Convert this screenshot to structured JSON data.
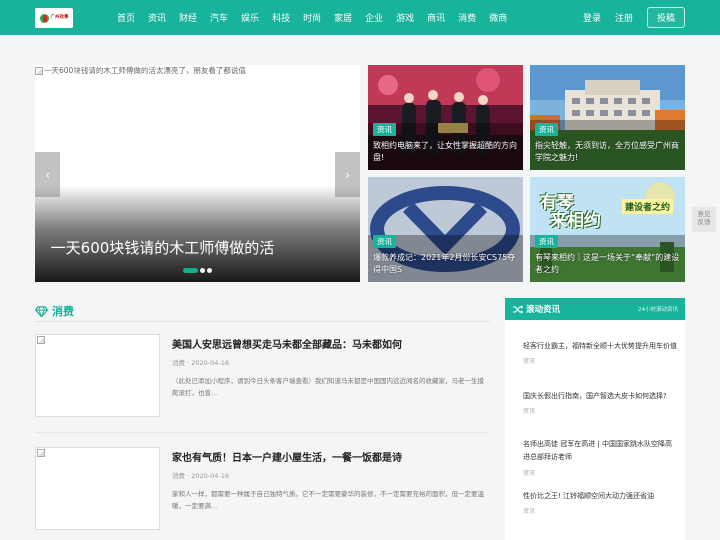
{
  "logo": {
    "text": "广州政事"
  },
  "nav": [
    "首页",
    "资讯",
    "财经",
    "汽车",
    "娱乐",
    "科技",
    "时尚",
    "家居",
    "企业",
    "游戏",
    "商讯",
    "消费",
    "微商"
  ],
  "header_right": {
    "login": "登录",
    "register": "注册",
    "submit": "投稿"
  },
  "slider": {
    "alt": "一天600块钱请的木工师傅做的活太漂亮了，朋友看了都说值",
    "title": "一天600块钱请的木工师傅做的活",
    "prev": "‹",
    "next": "›"
  },
  "tiles": [
    {
      "tag": "资讯",
      "title": "致相约电脑来了，让女性掌握超酷的方向盘!"
    },
    {
      "tag": "资讯",
      "title": "指尖轻触，无须到访，全方位感受广州商学院之魅力!"
    },
    {
      "tag": "资讯",
      "title": "爆款养成记：2021年2月份长安CS75夺得中国S"
    },
    {
      "tag": "资讯",
      "title": "有琴来相约｜这是一场关于“奉献”的建设者之约"
    }
  ],
  "tile4_art": {
    "line1": "有琴",
    "line2": "来相约",
    "line3": "建设者之约"
  },
  "feedback": {
    "line1": "意见",
    "line2": "反馈"
  },
  "section": {
    "title": "消费"
  },
  "articles": [
    {
      "title": "美国人安思远曾想买走马未都全部藏品：马未都如何",
      "meta": "消费 · 2020-04-16",
      "desc": "（此处已添加小程序，请到今日头条客户端查看）我们知道马未都是中国国内远近闻名的收藏家，马老一生摸爬滚打，也曾..."
    },
    {
      "title": "家也有气质！日本一户建小屋生活，一餐一饭都是诗",
      "meta": "消费 · 2020-04-16",
      "desc": "家和人一样，都需要一种属于自己独特气质。它不一定需要豪华的装修，不一定需要充裕的面积，但一定要温暖，一定要满..."
    }
  ],
  "sidebar": {
    "title": "滚动资讯",
    "subtitle": "24小时滚动资讯",
    "items": [
      {
        "title": "轻客行业霸主，福特新全顺十大优势提升用车价值",
        "sub": "资讯"
      },
      {
        "title": "国庆长假出行指南，国产智选大皮卡如何选择?",
        "sub": "资讯"
      },
      {
        "title": "名师出高徒 冠军在高进 | 中国国家跳水队空降高进总部拜访老师",
        "sub": "资讯"
      },
      {
        "title": "性价比之王! 江铃福顺空间大动力强还省油",
        "sub": "资讯"
      }
    ]
  },
  "colors": {
    "brand": "#17b39a",
    "header": "#17b39a"
  }
}
